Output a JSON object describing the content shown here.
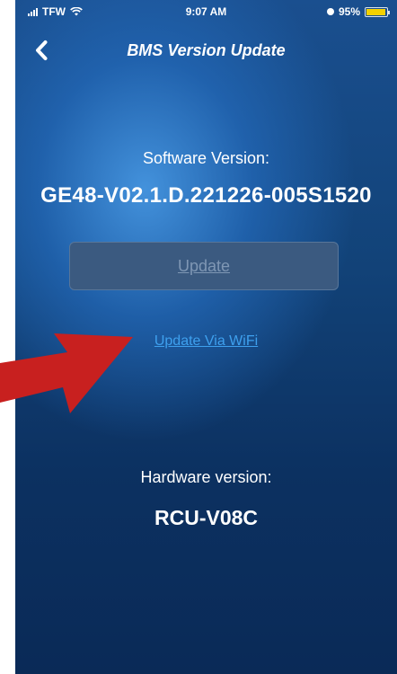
{
  "status_bar": {
    "carrier": "TFW",
    "time": "9:07 AM",
    "battery": "95%",
    "battery_level": 0.95,
    "battery_color": "#f5d100"
  },
  "nav": {
    "title": "BMS Version Update",
    "back_icon": "chevron-left-icon"
  },
  "software": {
    "label": "Software Version:",
    "value": "GE48-V02.1.D.221226-005S1520"
  },
  "update_button": {
    "label": "Update"
  },
  "wifi_link": {
    "label": "Update Via WiFi"
  },
  "hardware": {
    "label": "Hardware version:",
    "value": "RCU-V08C"
  },
  "annotation": {
    "icon": "red-arrow-icon",
    "color": "#c8201f"
  }
}
